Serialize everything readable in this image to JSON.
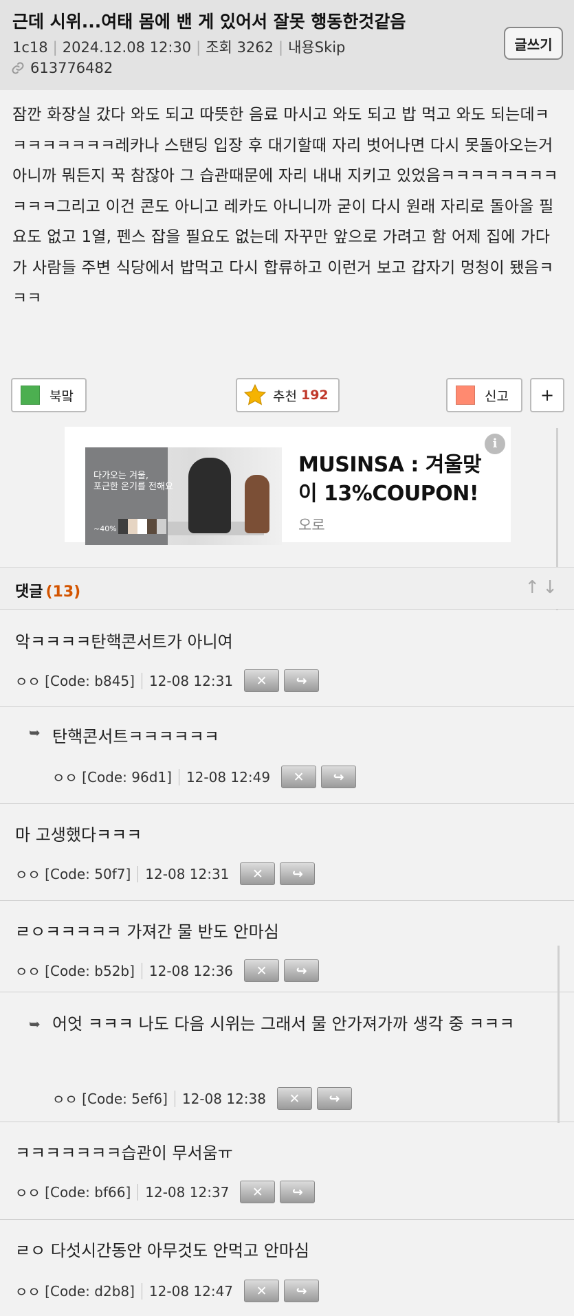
{
  "post": {
    "title": "근데 시위...여태 몸에 밴 게 있어서 잘못 행동한것같음",
    "author": "1c18",
    "datetime": "2024.12.08 12:30",
    "views_label": "조회",
    "views": "3262",
    "skip_label": "내용Skip",
    "post_number": "613776482",
    "write_button": "글쓰기",
    "content": "잠깐 화장실 갔다 와도 되고 따뜻한 음료 마시고 와도 되고 밥 먹고 와도 되는데ㅋㅋㅋㅋㅋㅋㅋㅋ레카나 스탠딩 입장 후 대기할때 자리 벗어나면 다시 못돌아오는거 아니까 뭐든지 꾹 참잖아 그 습관때문에 자리 내내 지키고 있었음ㅋㅋㅋㅋㅋㅋㅋㅋㅋㅋㅋ그리고 이건 콘도 아니고 레카도 아니니까 굳이 다시 원래 자리로 돌아올 필요도 없고 1열, 펜스 잡을 필요도 없는데 자꾸만 앞으로 가려고 함 어제 집에 가다가 사람들 주변 식당에서 밥먹고 다시 합류하고 이런거 보고 갑자기 멍청이 됐음ㅋㅋㅋ"
  },
  "actions": {
    "bookmark": "북맠",
    "recommend": "추천",
    "recommend_count": "192",
    "report": "신고",
    "more": "+",
    "bookmark_color": "#4caf50",
    "report_color": "#ff8a70",
    "star_color": "#f5b301"
  },
  "ad": {
    "image_line1": "다가오는 겨울,",
    "image_line2": "포근한 온기를 전해요",
    "image_percent": "~40%",
    "headline_line1": "MUSINSA : 겨울맞",
    "headline_line2": "이 13%COUPON!",
    "source": "오로",
    "info_icon": "i"
  },
  "comments_section": {
    "label": "댓글",
    "count": "(13)",
    "sort_icons": "↑↓"
  },
  "comments": [
    {
      "text": "악ㅋㅋㅋㅋ탄핵콘서트가 아니여",
      "author": "ㅇㅇ",
      "code": "[Code: b845]",
      "time": "12-08 12:31"
    },
    {
      "text": "탄핵콘서트ㅋㅋㅋㅋㅋㅋ",
      "author": "ㅇㅇ",
      "code": "[Code: 96d1]",
      "time": "12-08 12:49"
    },
    {
      "text": "마 고생했다ㅋㅋㅋ",
      "author": "ㅇㅇ",
      "code": "[Code: 50f7]",
      "time": "12-08 12:31"
    },
    {
      "text": "ㄹㅇㅋㅋㅋㅋㅋ 가져간 물 반도 안마심",
      "author": "ㅇㅇ",
      "code": "[Code: b52b]",
      "time": "12-08 12:36"
    },
    {
      "text": "어엇 ㅋㅋㅋ 나도 다음 시위는 그래서 물 안가져가까 생각 중 ㅋㅋㅋ",
      "author": "ㅇㅇ",
      "code": "[Code: 5ef6]",
      "time": "12-08 12:38"
    },
    {
      "text": "ㅋㅋㅋㅋㅋㅋㅋ습관이 무서움ㅠ",
      "author": "ㅇㅇ",
      "code": "[Code: bf66]",
      "time": "12-08 12:37"
    },
    {
      "text": "ㄹㅇ 다섯시간동안 아무것도 안먹고 안마심",
      "author": "ㅇㅇ",
      "code": "[Code: d2b8]",
      "time": "12-08 12:47"
    }
  ],
  "icons": {
    "delete": "✕",
    "reply": "↪",
    "reply_indicator": "➥",
    "link": "link-icon"
  }
}
